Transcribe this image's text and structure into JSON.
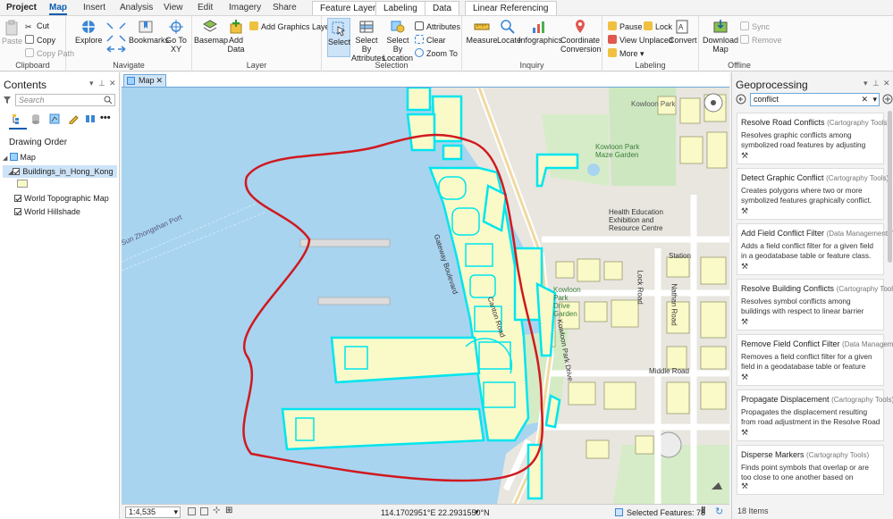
{
  "tabs": {
    "items": [
      "Project",
      "Map",
      "Insert",
      "Analysis",
      "View",
      "Edit",
      "Imagery",
      "Share"
    ],
    "contextual": [
      "Feature Layer",
      "Labeling",
      "Data",
      "Linear Referencing"
    ]
  },
  "ribbon": {
    "clipboard": {
      "label": "Clipboard",
      "paste": "Paste",
      "cut": "Cut",
      "copy": "Copy",
      "copy_path": "Copy Path"
    },
    "navigate": {
      "label": "Navigate",
      "explore": "Explore",
      "bookmarks": "Bookmarks",
      "goto": "Go To XY"
    },
    "layer": {
      "label": "Layer",
      "basemap": "Basemap",
      "add_data": "Add Data",
      "add_graphics": "Add Graphics Layer"
    },
    "selection": {
      "label": "Selection",
      "select": "Select",
      "by_attr": "Select By Attributes",
      "by_loc": "Select By Location",
      "attributes": "Attributes",
      "clear": "Clear",
      "zoom_to": "Zoom To"
    },
    "inquiry": {
      "label": "Inquiry",
      "measure": "Measure",
      "locate": "Locate",
      "infographics": "Infographics",
      "coord": "Coordinate Conversion"
    },
    "labeling": {
      "label": "Labeling",
      "pause": "Pause",
      "lock": "Lock",
      "view_unplaced": "View Unplaced",
      "more": "More",
      "convert": "Convert"
    },
    "offline": {
      "label": "Offline",
      "download": "Download Map",
      "sync": "Sync",
      "remove": "Remove"
    }
  },
  "contents": {
    "title": "Contents",
    "search_placeholder": "Search",
    "drawing_order": "Drawing Order",
    "map": "Map",
    "layers": [
      "Buildings_in_Hong_Kong",
      "World Topographic Map",
      "World Hillshade"
    ]
  },
  "map": {
    "tab": "Map",
    "labels": {
      "kowloon_park": "Kowloon Park",
      "maze_garden": "Kowloon Park Maze Garden",
      "health_education": "Health Education Exhibition and Resource Centre",
      "canton_road": "Canton Road",
      "gateway_blvd": "Gateway Boulevard",
      "kowloon_park_drive": "Kowloon Park Drive",
      "nathan_road": "Nathan Road",
      "lock_road": "Lock Road",
      "middle_road": "Middle Road",
      "kowloon_park_drive_garden": "Kowloon Park Drive Garden",
      "station": "Station",
      "port": "Sun Zhongshan Port"
    },
    "scale": "1:4,535",
    "coords": "114.1702951°E 22.2931550°N",
    "selected": "Selected Features: 78"
  },
  "geo": {
    "title": "Geoprocessing",
    "search_value": "conflict",
    "items_count": "18 Items",
    "tools": [
      {
        "name": "Resolve Road Conflicts",
        "toolbox": "(Cartography Tools)",
        "desc": "Resolves graphic conflicts among symbolized road features by adjusting portions of line..."
      },
      {
        "name": "Detect Graphic Conflict",
        "toolbox": "(Cartography Tools)",
        "desc": "Creates polygons where two or more symbolized features graphically conflict."
      },
      {
        "name": "Add Field Conflict Filter",
        "toolbox": "(Data Management T...",
        "desc": "Adds a field conflict filter for a given field in a geodatabase table or feature class."
      },
      {
        "name": "Resolve Building Conflicts",
        "toolbox": "(Cartography Tools)",
        "desc": "Resolves symbol conflicts among buildings with respect to linear barrier features by..."
      },
      {
        "name": "Remove Field Conflict Filter",
        "toolbox": "(Data Managem...",
        "desc": "Removes a field conflict filter for a given field in a geodatabase table or feature class."
      },
      {
        "name": "Propagate Displacement",
        "toolbox": "(Cartography Tools)",
        "desc": "Propagates the displacement resulting from road adjustment in the Resolve Road Conflic..."
      },
      {
        "name": "Disperse Markers",
        "toolbox": "(Cartography Tools)",
        "desc": "Finds point symbols that overlap or are too close to one another based on symbology a..."
      }
    ]
  },
  "colors": {
    "accent": "#0b5cad",
    "selection": "#00e5ee",
    "lasso": "#d0191f",
    "water": "#a8d4f0",
    "building": "#fafac8"
  }
}
